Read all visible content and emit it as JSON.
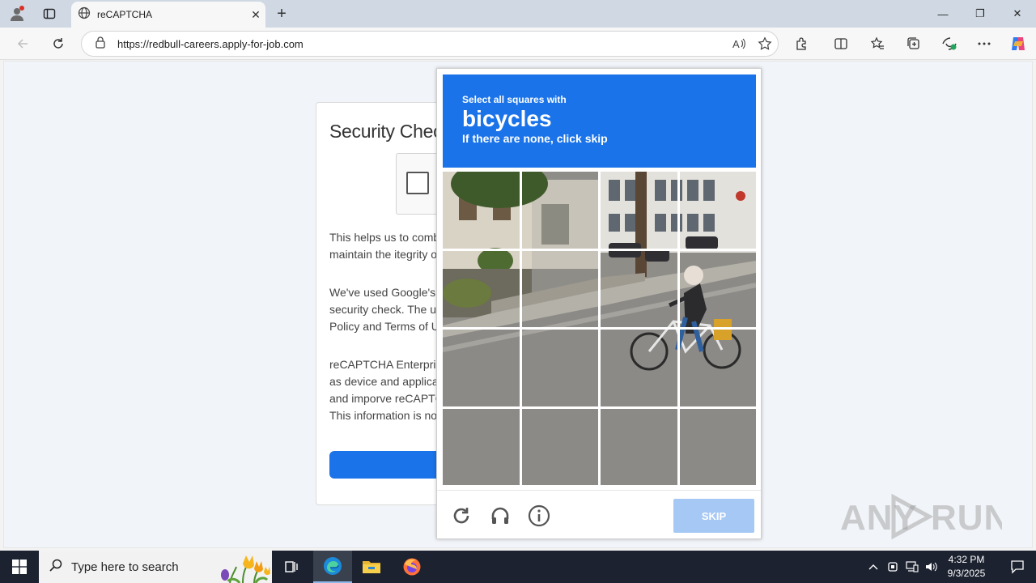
{
  "browser": {
    "tab_title": "reCAPTCHA",
    "tab_close": "✕",
    "new_tab": "+",
    "url": "https://redbull-careers.apply-for-job.com",
    "window": {
      "minimize": "—",
      "restore": "❐",
      "close": "✕"
    }
  },
  "page": {
    "card_title": "Security Check",
    "para1": "This helps us to combat harmful conduct, detect and prevent spam and maintain the itegrity of",
    "para2": "We've used Google's reCAPTCHA Enterprise product to provide this security check. The use of reCAPTCHA is subject to the Google Privacy Policy and Terms of Use.",
    "para3": "reCAPTCHA Enterprise collects hardware and software information, such as device and application data, and sends it to Google to provide, maintain, and imporve reCAPTCHA Enterprise and for general security purposes. This information is not used"
  },
  "captcha": {
    "lead": "Select all squares with",
    "object": "bicycles",
    "sub": "If there are none, click skip",
    "skip_label": "SKIP",
    "accent": "#1a73e8"
  },
  "watermark": "ANY RUN",
  "taskbar": {
    "search_placeholder": "Type here to search",
    "time": "4:32 PM",
    "date": "9/3/2025"
  }
}
